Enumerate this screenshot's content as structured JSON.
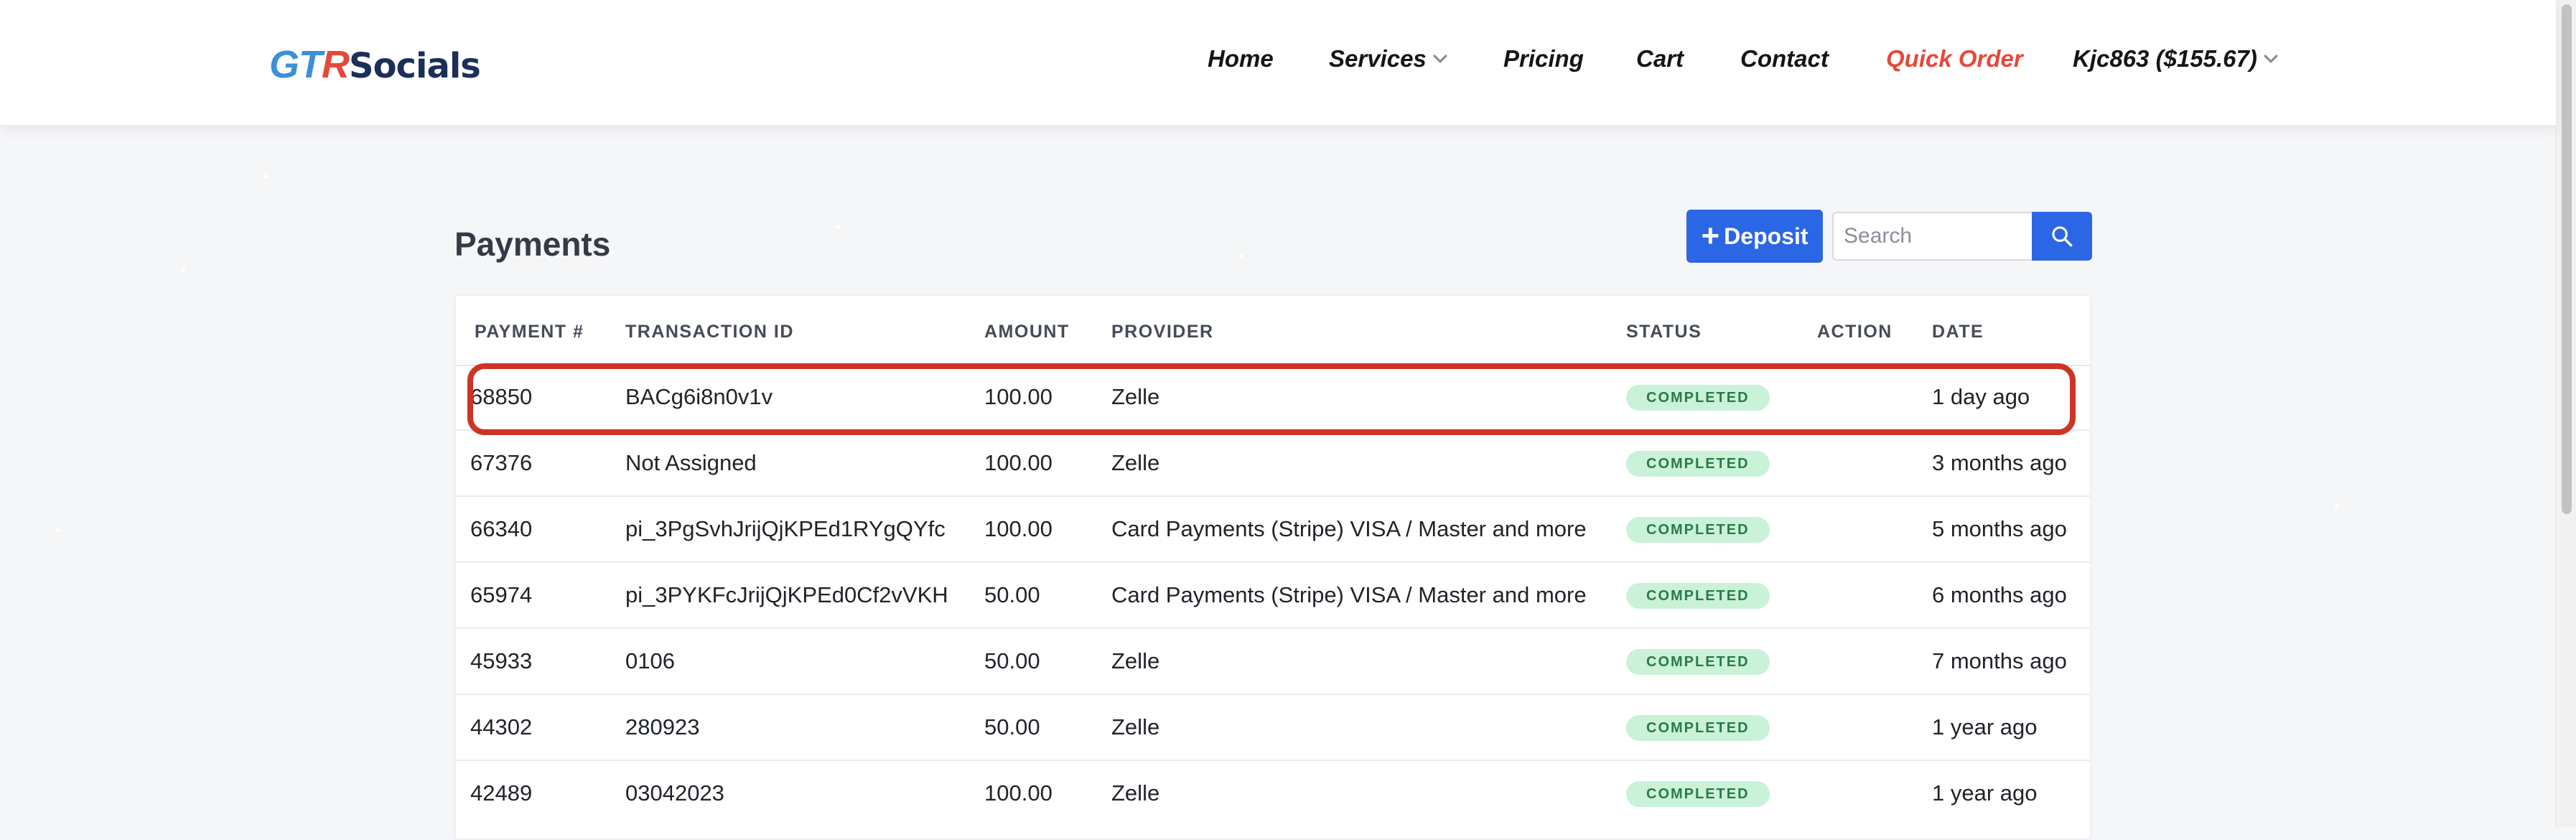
{
  "header": {
    "logo": {
      "part1": "GT",
      "part2": "R",
      "part3": "Socials"
    },
    "nav": [
      {
        "label": "Home",
        "has_dropdown": false,
        "accent": false
      },
      {
        "label": "Services",
        "has_dropdown": true,
        "accent": false
      },
      {
        "label": "Pricing",
        "has_dropdown": false,
        "accent": false
      },
      {
        "label": "Cart",
        "has_dropdown": false,
        "accent": false
      },
      {
        "label": "Contact",
        "has_dropdown": false,
        "accent": false
      },
      {
        "label": "Quick Order",
        "has_dropdown": false,
        "accent": true
      },
      {
        "label": "Kjc863 ($155.67)",
        "has_dropdown": true,
        "accent": false
      }
    ]
  },
  "page": {
    "title": "Payments",
    "deposit_label": "Deposit",
    "search_placeholder": "Search"
  },
  "table": {
    "columns": [
      "PAYMENT #",
      "TRANSACTION ID",
      "AMOUNT",
      "PROVIDER",
      "STATUS",
      "ACTION",
      "DATE"
    ],
    "rows": [
      {
        "payment": "68850",
        "transaction": "BACg6i8n0v1v",
        "amount": "100.00",
        "provider": "Zelle",
        "status": "COMPLETED",
        "action": "",
        "date": "1 day ago",
        "highlighted": true
      },
      {
        "payment": "67376",
        "transaction": "Not Assigned",
        "amount": "100.00",
        "provider": "Zelle",
        "status": "COMPLETED",
        "action": "",
        "date": "3 months ago",
        "highlighted": false
      },
      {
        "payment": "66340",
        "transaction": "pi_3PgSvhJrijQjKPEd1RYgQYfc",
        "amount": "100.00",
        "provider": "Card Payments (Stripe) VISA / Master and more",
        "status": "COMPLETED",
        "action": "",
        "date": "5 months ago",
        "highlighted": false
      },
      {
        "payment": "65974",
        "transaction": "pi_3PYKFcJrijQjKPEd0Cf2vVKH",
        "amount": "50.00",
        "provider": "Card Payments (Stripe) VISA / Master and more",
        "status": "COMPLETED",
        "action": "",
        "date": "6 months ago",
        "highlighted": false
      },
      {
        "payment": "45933",
        "transaction": "0106",
        "amount": "50.00",
        "provider": "Zelle",
        "status": "COMPLETED",
        "action": "",
        "date": "7 months ago",
        "highlighted": false
      },
      {
        "payment": "44302",
        "transaction": "280923",
        "amount": "50.00",
        "provider": "Zelle",
        "status": "COMPLETED",
        "action": "",
        "date": "1 year ago",
        "highlighted": false
      },
      {
        "payment": "42489",
        "transaction": "03042023",
        "amount": "100.00",
        "provider": "Zelle",
        "status": "COMPLETED",
        "action": "",
        "date": "1 year ago",
        "highlighted": false
      }
    ]
  },
  "colors": {
    "accent": "#2b66e4",
    "quick_order": "#e5493a",
    "highlight_outline": "#cd3427",
    "status_bg": "#c9f2d9",
    "status_text": "#2b7a49"
  }
}
